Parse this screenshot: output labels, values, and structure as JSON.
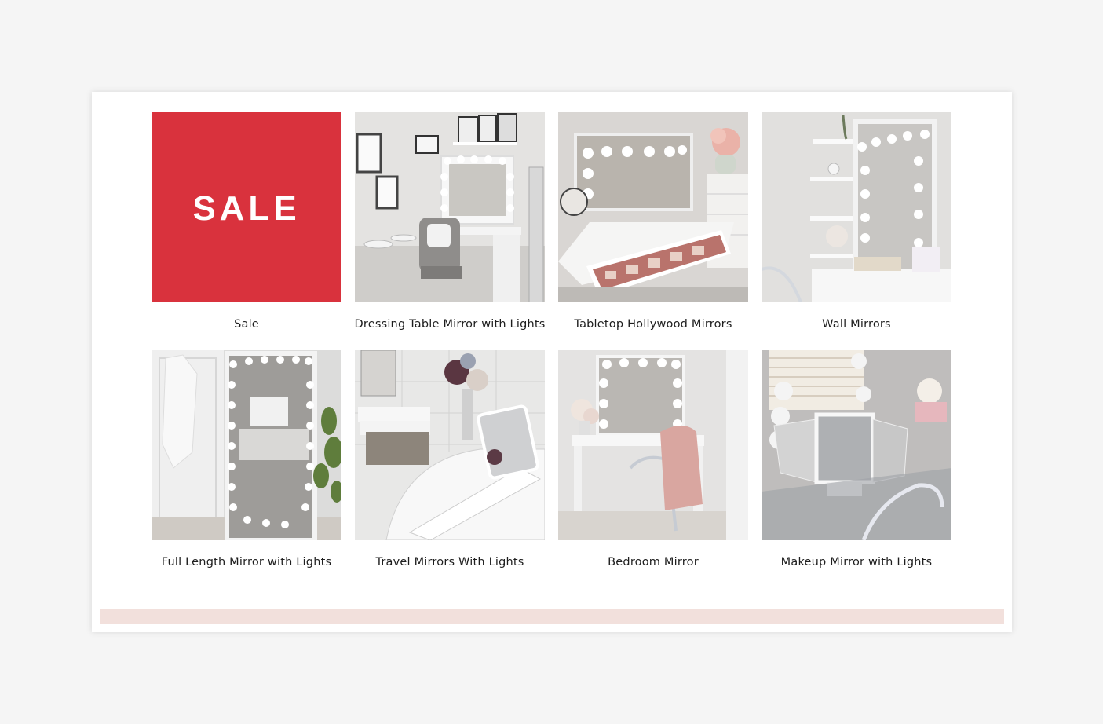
{
  "collections": [
    {
      "label": "Sale",
      "image": "sale-banner",
      "banner_text": "SALE"
    },
    {
      "label": "Dressing Table Mirror with Lights",
      "image": "dressing-table-photo"
    },
    {
      "label": "Tabletop Hollywood Mirrors",
      "image": "tabletop-mirror-photo"
    },
    {
      "label": "Wall Mirrors",
      "image": "wall-mirror-photo"
    },
    {
      "label": "Full Length Mirror with Lights",
      "image": "full-length-mirror-photo"
    },
    {
      "label": "Travel Mirrors With Lights",
      "image": "travel-mirror-photo"
    },
    {
      "label": "Bedroom Mirror",
      "image": "bedroom-mirror-photo"
    },
    {
      "label": "Makeup Mirror with Lights",
      "image": "makeup-mirror-photo"
    }
  ],
  "colors": {
    "sale_red": "#d9323d",
    "footer_band": "#f2e0dc",
    "page_bg": "#f5f5f5"
  }
}
